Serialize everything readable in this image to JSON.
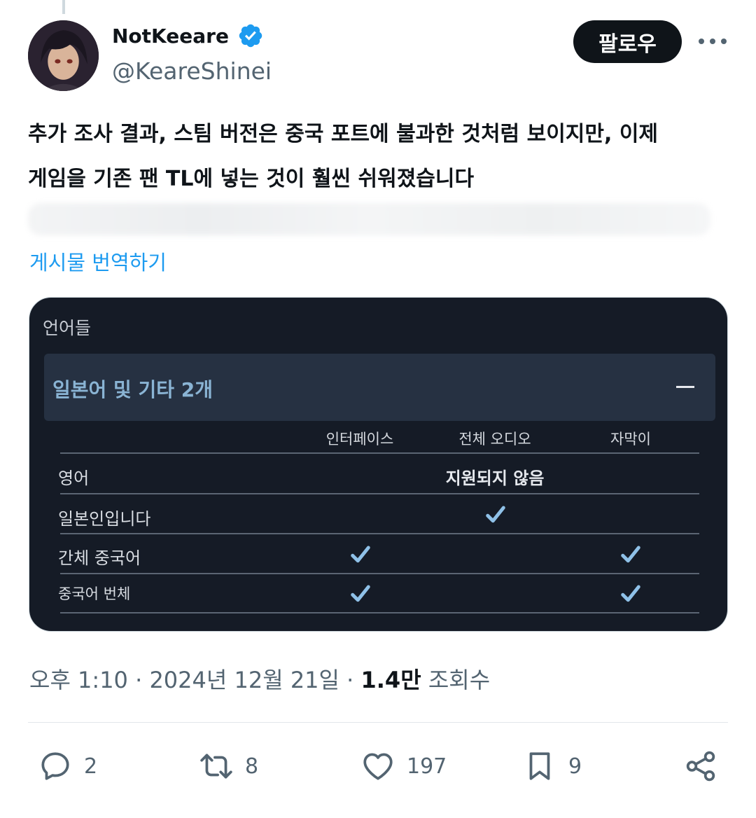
{
  "author": {
    "display_name": "NotKeeare",
    "handle": "@KeareShinei",
    "verified": true
  },
  "follow_label": "팔로우",
  "tweet": {
    "text_line1": "추가 조사 결과, 스팀 버전은 중국 포트에 불과한 것처럼 보이지만, 이제",
    "text_line2": "게임을 기존 팬 TL에 넣는 것이 훨씬 쉬워졌습니다",
    "translate_label": "게시물 번역하기"
  },
  "media": {
    "heading": "언어들",
    "section_title": "일본어 및 기타 2개",
    "columns": [
      "인터페이스",
      "전체 오디오",
      "자막이"
    ],
    "rows": [
      {
        "label": "영어",
        "note": "지원되지 않음",
        "interface": false,
        "audio": false,
        "subtitles": false
      },
      {
        "label": "일본인입니다",
        "note": "",
        "interface": false,
        "audio": true,
        "subtitles": false
      },
      {
        "label": "간체 중국어",
        "note": "",
        "interface": true,
        "audio": false,
        "subtitles": true
      },
      {
        "label": "중국어 번체",
        "note": "",
        "interface": true,
        "audio": false,
        "subtitles": true
      }
    ]
  },
  "meta": {
    "time": "오후 1:10",
    "separator": "·",
    "date": "2024년 12월 21일",
    "views_count": "1.4만",
    "views_label": "조회수"
  },
  "actions": {
    "replies": "2",
    "reposts": "8",
    "likes": "197",
    "bookmarks": "9"
  },
  "colors": {
    "accent": "#1d9bf0",
    "text": "#0f1419",
    "secondary": "#536471",
    "card_bg": "#151b26",
    "check": "#8fc1e8"
  }
}
